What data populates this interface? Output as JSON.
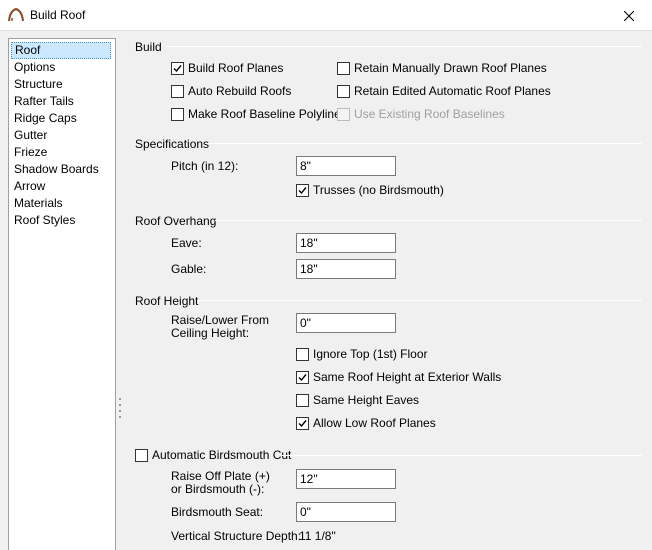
{
  "window": {
    "title": "Build Roof"
  },
  "nav": {
    "items": [
      "Roof",
      "Options",
      "Structure",
      "Rafter Tails",
      "Ridge Caps",
      "Gutter",
      "Frieze",
      "Shadow Boards",
      "Arrow",
      "Materials",
      "Roof Styles"
    ],
    "selected": "Roof"
  },
  "build": {
    "title": "Build",
    "build_roof_planes": {
      "label": "Build Roof Planes",
      "checked": true
    },
    "auto_rebuild": {
      "label": "Auto Rebuild Roofs",
      "checked": false
    },
    "baseline_polylines": {
      "label": "Make Roof Baseline Polylines",
      "checked": false
    },
    "retain_manual": {
      "label": "Retain Manually Drawn Roof Planes",
      "checked": false
    },
    "retain_edited": {
      "label": "Retain Edited Automatic Roof Planes",
      "checked": false
    },
    "use_existing": {
      "label": "Use Existing Roof Baselines",
      "checked": false,
      "disabled": true
    }
  },
  "specifications": {
    "title": "Specifications",
    "pitch_label": "Pitch (in 12):",
    "pitch_value": "8\"",
    "trusses": {
      "label": "Trusses (no Birdsmouth)",
      "checked": true
    }
  },
  "overhang": {
    "title": "Roof Overhang",
    "eave_label": "Eave:",
    "eave_value": "18\"",
    "gable_label": "Gable:",
    "gable_value": "18\""
  },
  "height": {
    "title": "Roof Height",
    "raise_label_1": "Raise/Lower From",
    "raise_label_2": "Ceiling Height:",
    "raise_value": "0\"",
    "ignore_top": {
      "label": "Ignore Top (1st) Floor",
      "checked": false
    },
    "same_exterior": {
      "label": "Same Roof Height at Exterior Walls",
      "checked": true
    },
    "same_eaves": {
      "label": "Same Height Eaves",
      "checked": false
    },
    "allow_low": {
      "label": "Allow Low Roof Planes",
      "checked": true
    }
  },
  "birdsmouth": {
    "title": "Automatic Birdsmouth Cut",
    "checked": false,
    "raise_label_1": "Raise Off Plate (+)",
    "raise_label_2": "or Birdsmouth (-):",
    "raise_value": "12\"",
    "seat_label": "Birdsmouth Seat:",
    "seat_value": "0\"",
    "depth_label": "Vertical Structure Depth:",
    "depth_value": "11 1/8\""
  }
}
